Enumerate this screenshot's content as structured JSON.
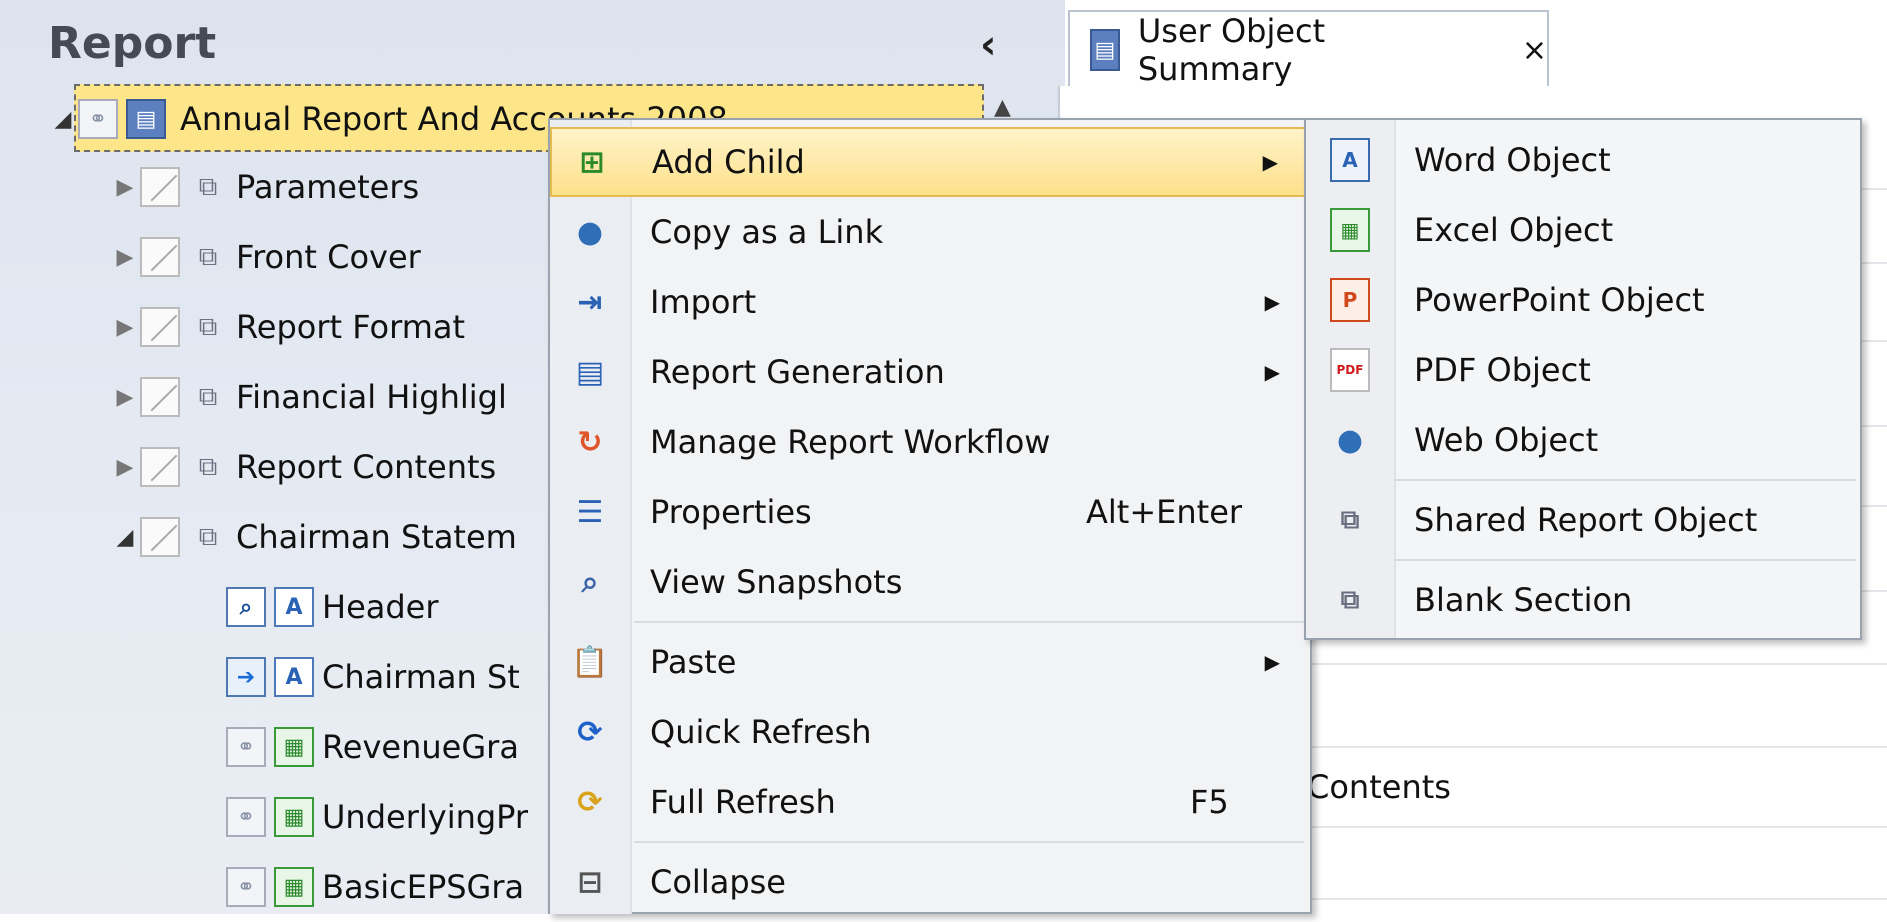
{
  "report_panel": {
    "title": "Report",
    "collapse_icon": "chevron-left-icon",
    "root": {
      "label": "Annual Report And Accounts 2008"
    },
    "items": [
      {
        "label": "Parameters",
        "expanded": false
      },
      {
        "label": "Front Cover",
        "expanded": false
      },
      {
        "label": "Report Format",
        "expanded": false
      },
      {
        "label": "Financial Highligl",
        "expanded": false
      },
      {
        "label": "Report Contents",
        "expanded": false
      },
      {
        "label": "Chairman Statem",
        "expanded": true
      }
    ],
    "children": [
      {
        "label": "Header"
      },
      {
        "label": "Chairman St"
      },
      {
        "label": "RevenueGra"
      },
      {
        "label": "UnderlyingPr"
      },
      {
        "label": "BasicEPSGra"
      }
    ]
  },
  "tab": {
    "label": "User Object Summary",
    "close": "×"
  },
  "content": {
    "contents_label": "Contents"
  },
  "context_menu": {
    "items": [
      {
        "label": "Add Child",
        "icon": "add-child-icon",
        "submenu": true
      },
      {
        "label": "Copy as a Link",
        "icon": "globe-icon"
      },
      {
        "label": "Import",
        "icon": "import-icon",
        "submenu": true
      },
      {
        "label": "Report Generation",
        "icon": "report-generation-icon",
        "submenu": true
      },
      {
        "label": "Manage Report Workflow",
        "icon": "workflow-icon"
      },
      {
        "label": "Properties",
        "icon": "properties-icon",
        "shortcut": "Alt+Enter"
      },
      {
        "label": "View Snapshots",
        "icon": "snapshots-icon"
      },
      {
        "label": "Paste",
        "icon": "paste-icon",
        "submenu": true
      },
      {
        "label": "Quick Refresh",
        "icon": "refresh-icon"
      },
      {
        "label": "Full Refresh",
        "icon": "full-refresh-icon",
        "shortcut": "F5"
      },
      {
        "label": "Collapse",
        "icon": "collapse-icon"
      }
    ],
    "submenu_arrow": "▶"
  },
  "add_child_submenu": {
    "items": [
      {
        "label": "Word Object",
        "icon": "word-icon"
      },
      {
        "label": "Excel Object",
        "icon": "excel-icon"
      },
      {
        "label": "PowerPoint Object",
        "icon": "powerpoint-icon"
      },
      {
        "label": "PDF Object",
        "icon": "pdf-icon"
      },
      {
        "label": "Web Object",
        "icon": "web-icon"
      },
      {
        "label": "Shared Report Object",
        "icon": "shared-report-icon"
      },
      {
        "label": "Blank Section",
        "icon": "blank-section-icon"
      }
    ]
  }
}
